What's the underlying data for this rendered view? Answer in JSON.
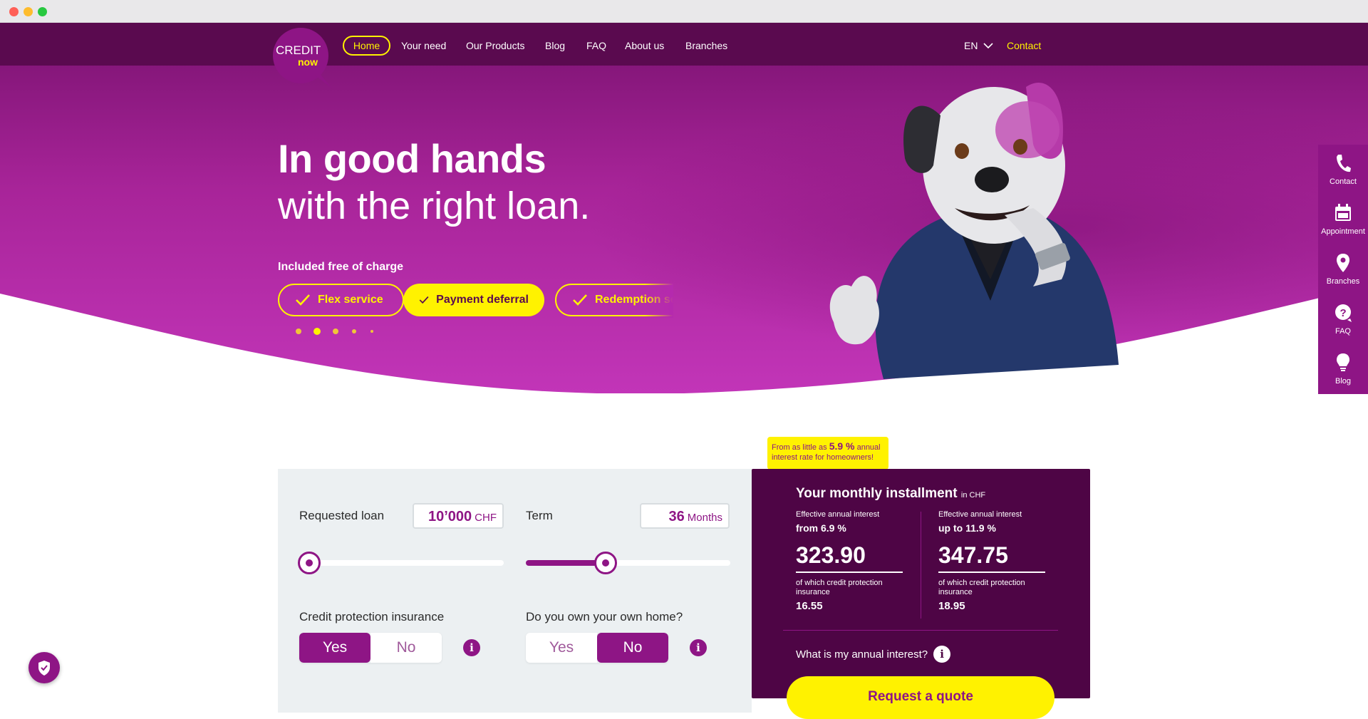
{
  "brand": {
    "logo_line1": "CREDIT",
    "logo_line2": "now",
    "primary_color": "#8e1585",
    "dark_color": "#5a0a4f",
    "accent_color": "#fff200"
  },
  "nav": {
    "items": [
      "Home",
      "Your need",
      "Our Products",
      "Blog",
      "FAQ",
      "About us",
      "Branches"
    ],
    "active": "Home",
    "language": "EN",
    "contact": "Contact"
  },
  "hero": {
    "title_bold": "In good hands",
    "title_regular": "with the right loan.",
    "included_label": "Included free of charge",
    "pills": [
      "Flex service",
      "Payment deferral",
      "Redemption ser"
    ],
    "carousel_dots": 5,
    "carousel_active": 2
  },
  "side_panel": {
    "items": [
      {
        "label": "Contact",
        "icon": "phone-icon"
      },
      {
        "label": "Appointment",
        "icon": "calendar-icon"
      },
      {
        "label": "Branches",
        "icon": "location-pin-icon"
      },
      {
        "label": "FAQ",
        "icon": "question-icon"
      },
      {
        "label": "Blog",
        "icon": "lightbulb-icon"
      }
    ]
  },
  "calculator": {
    "loan_label": "Requested loan",
    "loan_value": "10’000",
    "loan_unit": "CHF",
    "loan_slider_fraction": 0.05,
    "term_label": "Term",
    "term_value": "36",
    "term_unit": "Months",
    "term_slider_fraction": 0.39,
    "insurance_label": "Credit protection insurance",
    "insurance_options": [
      "Yes",
      "No"
    ],
    "insurance_selected": "Yes",
    "home_label": "Do you own your own home?",
    "home_options": [
      "Yes",
      "No"
    ],
    "home_selected": "No"
  },
  "promo": {
    "prefix": "From as little as",
    "rate": "5.9 %",
    "suffix": "annual interest rate for homeowners!"
  },
  "result": {
    "title": "Your monthly installment",
    "title_unit": "in CHF",
    "columns": [
      {
        "label": "Effective annual interest",
        "rate": "from 6.9 %",
        "amount": "323.90",
        "insurance_label": "of which credit protection insurance",
        "insurance_value": "16.55"
      },
      {
        "label": "Effective annual interest",
        "rate": "up to 11.9 %",
        "amount": "347.75",
        "insurance_label": "of which credit protection insurance",
        "insurance_value": "18.95"
      }
    ],
    "annual_interest_question": "What is my annual interest?",
    "cta": "Request a quote"
  }
}
